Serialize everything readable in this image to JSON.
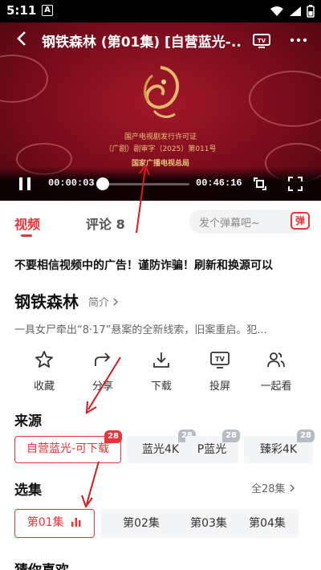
{
  "status": {
    "time": "5:11",
    "notif_letter": "A"
  },
  "player": {
    "title": "钢铁森林 (第01集) [自营蓝光-...",
    "license_line1": "国产电视剧发行许可证",
    "license_line2": "（广剧）剧审字（2025）第011号",
    "license_line3": "国家广播电视总局",
    "current_time": "00:00:03",
    "duration": "00:46:16",
    "progress": 0.001
  },
  "tabs": {
    "video": "视频",
    "comment": "评论 8",
    "danmu_placeholder": "发个弹幕吧~",
    "danmu_btn": "弹"
  },
  "warning": "不要相信视频中的广告！谨防诈骗！刷新和换源可以",
  "show": {
    "title": "钢铁森林",
    "intro_link": "简介",
    "description": "一具女尸牵出“8·17”悬案的全新线索，旧案重启。犯..."
  },
  "actions": [
    {
      "label": "收藏",
      "icon": "star-icon"
    },
    {
      "label": "分享",
      "icon": "share-icon"
    },
    {
      "label": "下载",
      "icon": "download-icon"
    },
    {
      "label": "投屏",
      "icon": "tv-cast-icon"
    },
    {
      "label": "一起看",
      "icon": "users-icon"
    }
  ],
  "sources": {
    "label": "来源",
    "items": [
      {
        "name": "自营蓝光-可下载",
        "count": "28"
      },
      {
        "name": "蓝光4K",
        "count": "28"
      },
      {
        "name": "P蓝光",
        "count": "28"
      },
      {
        "name": "臻彩4K",
        "count": "28"
      }
    ]
  },
  "episodes": {
    "label": "选集",
    "all": "全28集",
    "items": [
      "第01集",
      "第02集",
      "第03集",
      "第04集"
    ]
  },
  "guess": "猜你喜欢",
  "colors": {
    "accent": "#e8343a",
    "player_bg": "#7a0c1c",
    "license_gold": "#e8c37a"
  }
}
